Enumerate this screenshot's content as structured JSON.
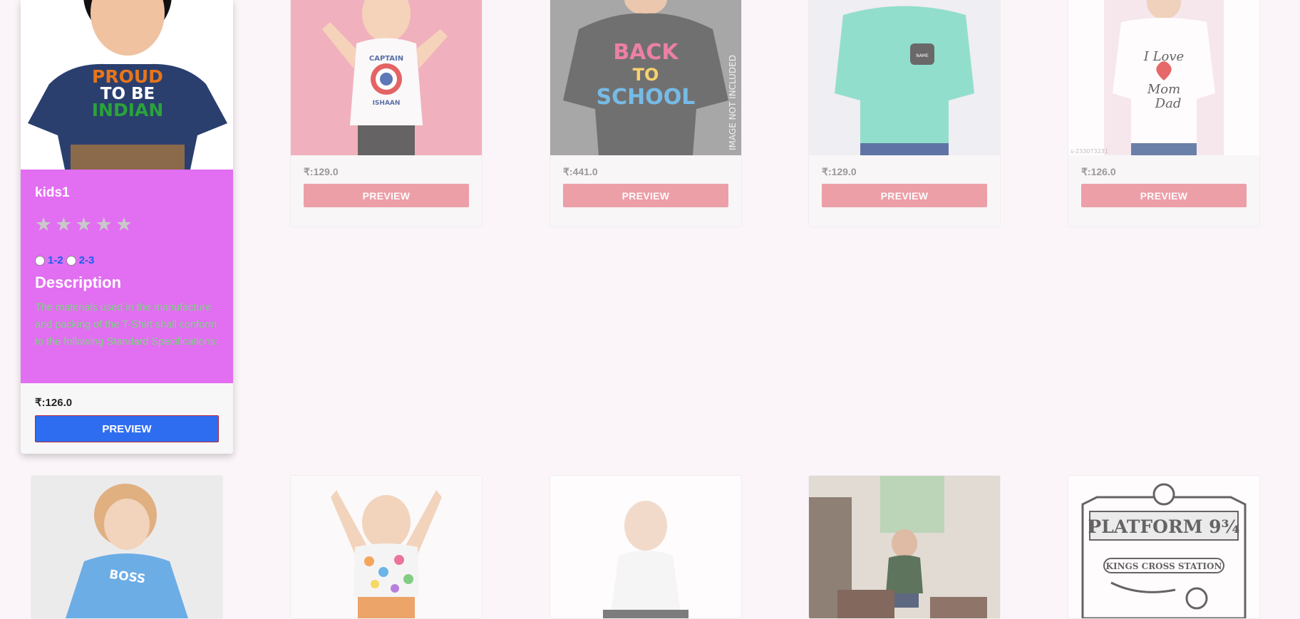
{
  "featured": {
    "title": "kids1",
    "stars": "★★★★★",
    "sizes": [
      "1-2",
      "2-3"
    ],
    "description_heading": "Description",
    "description": "The materials used in the manufacture and packing of the T-Shirt shall conform to the following Standard Specifications:",
    "price": "₹:126.0",
    "button": "PREVIEW",
    "shirt_print": [
      "PROUD",
      "TO BE",
      "INDIAN"
    ]
  },
  "top_row": [
    {
      "price": "₹:129.0",
      "button": "PREVIEW",
      "print": [
        "CAPTAIN",
        "ISHAAN"
      ]
    },
    {
      "price": "₹:441.0",
      "button": "PREVIEW",
      "print": [
        "BACK",
        "TO",
        "SCHOOL"
      ],
      "overlay": "IMAGE NOT INCLUDED"
    },
    {
      "price": "₹:129.0",
      "button": "PREVIEW",
      "print": [
        "NAME"
      ]
    },
    {
      "price": "₹:126.0",
      "button": "PREVIEW",
      "print": [
        "I Love",
        "Mom",
        "Dad"
      ],
      "watermark": "s-233073231"
    }
  ],
  "bottom_row": [
    {
      "print": "BOSS"
    },
    {
      "print": ""
    },
    {
      "print": ""
    },
    {
      "print": ""
    },
    {
      "print": [
        "PLATFORM 9¾",
        "KINGS CROSS STATION"
      ]
    }
  ],
  "colors": {
    "accent": "#e8838c",
    "featured_bg": "#e26ef2",
    "primary_button": "#2f6df0"
  }
}
